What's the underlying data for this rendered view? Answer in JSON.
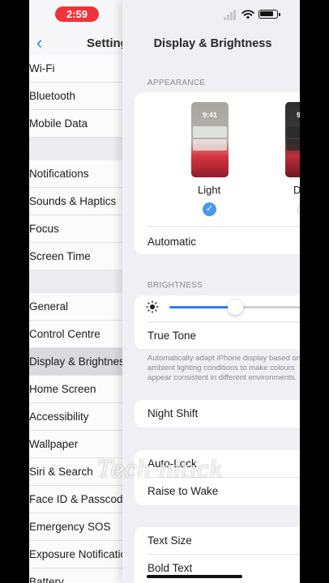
{
  "status_bar": {
    "time": "2:59"
  },
  "left_nav": {
    "title": "Settings",
    "items": [
      {
        "label": "Wi-Fi"
      },
      {
        "label": "Bluetooth"
      },
      {
        "label": "Mobile Data"
      },
      {
        "label": "Notifications"
      },
      {
        "label": "Sounds & Haptics"
      },
      {
        "label": "Focus"
      },
      {
        "label": "Screen Time"
      },
      {
        "label": "General"
      },
      {
        "label": "Control Centre"
      },
      {
        "label": "Display & Brightness",
        "selected": true
      },
      {
        "label": "Home Screen"
      },
      {
        "label": "Accessibility"
      },
      {
        "label": "Wallpaper"
      },
      {
        "label": "Siri & Search"
      },
      {
        "label": "Face ID & Passcode"
      },
      {
        "label": "Emergency SOS"
      },
      {
        "label": "Exposure Notifications"
      },
      {
        "label": "Battery"
      }
    ]
  },
  "detail": {
    "title": "Display & Brightness",
    "appearance": {
      "header": "APPEARANCE",
      "light_label": "Light",
      "dark_label": "Dark",
      "thumb_time": "9:41",
      "selected": "Light",
      "automatic_label": "Automatic"
    },
    "brightness": {
      "header": "BRIGHTNESS",
      "level": 0.45,
      "true_tone_label": "True Tone",
      "true_tone_footer": "Automatically adapt iPhone display based on ambient lighting conditions to make colours appear consistent in different environments."
    },
    "night_shift_label": "Night Shift",
    "auto_lock_label": "Auto-Lock",
    "raise_to_wake_label": "Raise to Wake",
    "text_size_label": "Text Size",
    "bold_text_label": "Bold Text"
  },
  "watermark": "Tech nitick",
  "colors": {
    "accent": "#2f7cf6",
    "status_pill": "#f0333a"
  }
}
